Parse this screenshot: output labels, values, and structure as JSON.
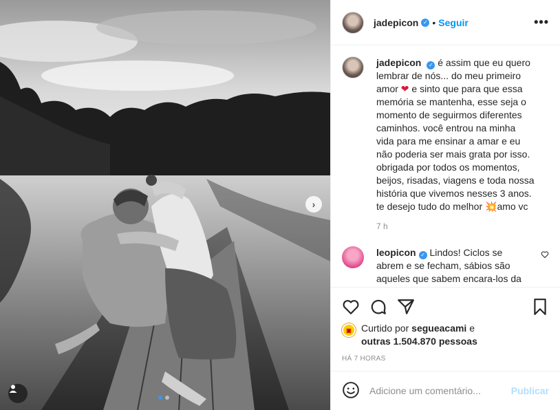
{
  "post": {
    "author": "jadepicon",
    "follow_label": "Seguir",
    "separator": "•",
    "more_icon": "more-horizontal-icon"
  },
  "caption": {
    "username": "jadepicon",
    "text_part1": "é assim que eu quero lembrar de nós... do meu primeiro amor ",
    "heart": "❤",
    "text_part2": " e sinto que para que essa memória se mantenha, esse seja o momento de seguirmos diferentes caminhos. você entrou na minha vida para me ensinar a amar e eu não poderia ser mais grata por isso. obrigada por todos os momentos, beijos, risadas, viagens e toda nossa história que vivemos nesses 3 anos. te desejo tudo do melhor ",
    "sparkle": "💥",
    "text_part3": "amo vc",
    "time": "7 h"
  },
  "comment": {
    "username": "leopicon",
    "text": "Lindos! Ciclos se abrem e se fecham, sábios são aqueles que sabem encara-los da melhor forma! O ciclo de vocês"
  },
  "likes": {
    "prefix": "Curtido por",
    "user": "segueacami",
    "connector": "e",
    "others": "outras 1.504.870 pessoas"
  },
  "posted_ago": "HÁ 7 HORAS",
  "add_comment": {
    "placeholder": "Adicione um comentário...",
    "publish_label": "Publicar"
  },
  "carousel": {
    "current": 1,
    "total": 2,
    "next_label": "›"
  },
  "colors": {
    "accent": "#0095f6",
    "verified": "#3897f0",
    "publish_disabled": "#b2dffc"
  }
}
